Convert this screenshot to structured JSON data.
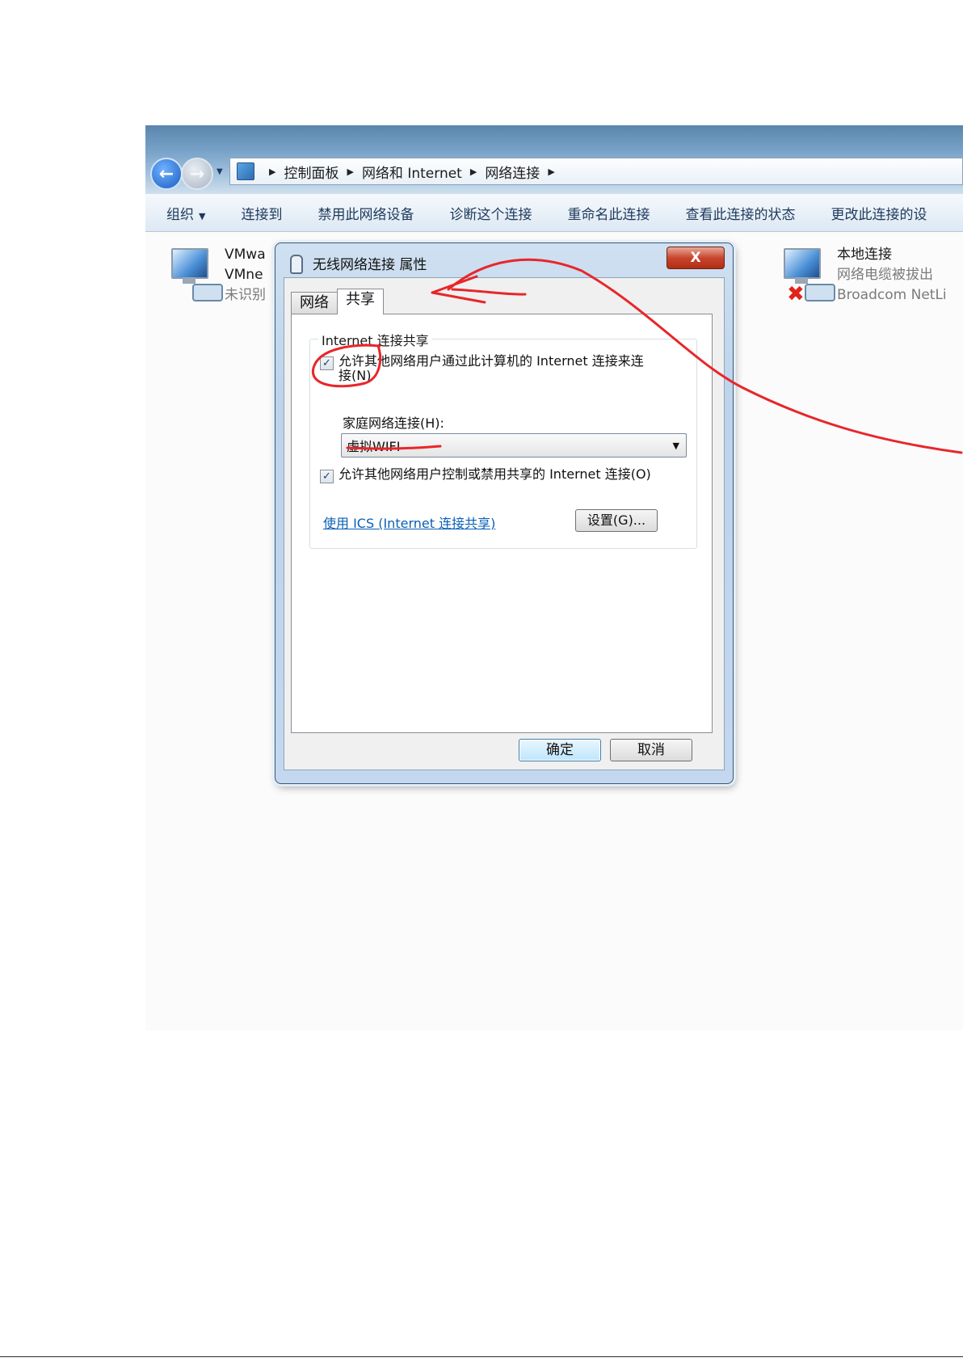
{
  "address_bar": {
    "crumbs": [
      "控制面板",
      "网络和 Internet",
      "网络连接"
    ]
  },
  "command_bar": {
    "organize": "组织",
    "connect_to": "连接到",
    "disable_device": "禁用此网络设备",
    "diagnose": "诊断这个连接",
    "rename": "重命名此连接",
    "view_status": "查看此连接的状态",
    "change_settings": "更改此连接的设"
  },
  "connections": [
    {
      "name": "VMwa",
      "device": "VMne",
      "status": "未识别"
    },
    {
      "name": "本地连接",
      "status": "网络电缆被拔出",
      "device": "Broadcom NetLi"
    }
  ],
  "dialog": {
    "title": "无线网络连接 属性",
    "close": "X",
    "tabs": [
      "网络",
      "共享"
    ],
    "group_title": "Internet 连接共享",
    "allow_share_label": "允许其他网络用户通过此计算机的 Internet 连接来连接(N)",
    "allow_share_checked": true,
    "home_network_label": "家庭网络连接(H):",
    "home_network_value": "虚拟WIFI",
    "allow_control_label": "允许其他网络用户控制或禁用共享的 Internet 连接(O)",
    "allow_control_checked": true,
    "ics_link": "使用 ICS (Internet 连接共享)",
    "settings_button": "设置(G)...",
    "ok": "确定",
    "cancel": "取消"
  },
  "colors": {
    "annotation": "#e8262a",
    "link": "#0a5fb4"
  }
}
